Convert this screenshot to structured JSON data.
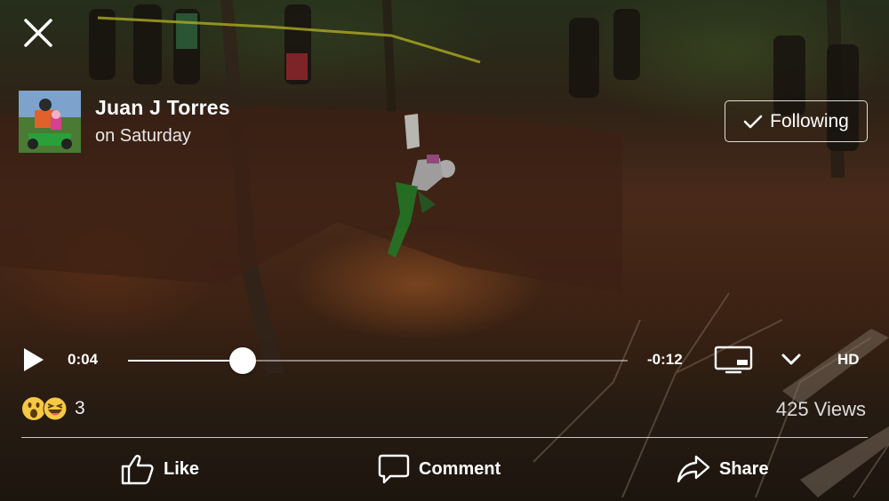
{
  "author": {
    "name": "Juan J Torres",
    "time": "on Saturday"
  },
  "follow": {
    "label": "Following",
    "icon": "checkmark-icon"
  },
  "close": {
    "icon": "close-icon"
  },
  "player": {
    "elapsed": "0:04",
    "remaining": "-0:12",
    "progress": 0.23,
    "quality": "HD",
    "play_icon": "play-icon",
    "cast_icon": "cast-icon",
    "more_icon": "chevron-down-icon"
  },
  "reactions": {
    "icons": [
      "wow-reaction-icon",
      "haha-reaction-icon"
    ],
    "count": "3"
  },
  "views": "425 Views",
  "actions": [
    {
      "label": "Like",
      "icon": "thumbs-up-icon"
    },
    {
      "label": "Comment",
      "icon": "comment-icon"
    },
    {
      "label": "Share",
      "icon": "share-icon"
    }
  ],
  "colors": {
    "overlay_text": "#ffffff",
    "reaction_yellow": "#f7c844"
  }
}
